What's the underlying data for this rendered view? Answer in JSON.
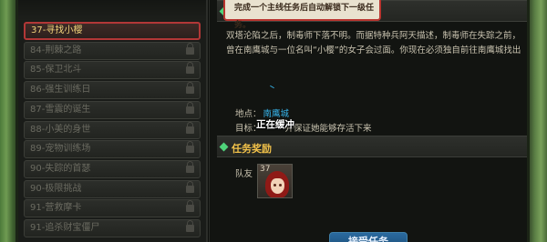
{
  "quest_list": [
    {
      "label": "37-寻找小樱",
      "active": true,
      "locked": false
    },
    {
      "label": "84-荆棘之路",
      "active": false,
      "locked": true
    },
    {
      "label": "85-保卫北斗",
      "active": false,
      "locked": true
    },
    {
      "label": "86-强生训练日",
      "active": false,
      "locked": true
    },
    {
      "label": "87-雪震的诞生",
      "active": false,
      "locked": true
    },
    {
      "label": "88-小美的身世",
      "active": false,
      "locked": true
    },
    {
      "label": "89-宠物训练场",
      "active": false,
      "locked": true
    },
    {
      "label": "90-失踪的首瑟",
      "active": false,
      "locked": true
    },
    {
      "label": "90-极限挑战",
      "active": false,
      "locked": true
    },
    {
      "label": "91-营救摩卡",
      "active": false,
      "locked": true
    },
    {
      "label": "91-追杀财宝僵尸",
      "active": false,
      "locked": true
    }
  ],
  "tooltip": "完成一个主线任务后自动解锁下一级任务。",
  "detail": {
    "description": "双塔沦陷之后，制毒师下落不明。而据特种兵阿天描述，制毒师在失踪之前，曾在南鹰城与一位名叫“小樱”的女子会过面。你现在必须独自前往南鹰城找出",
    "location_label": "地点：",
    "location_value": "南鹰城",
    "goal_label": "目标：",
    "goal_value": "并保证她能够存活下来",
    "loading_text": "正在缓冲"
  },
  "reward": {
    "section_title": "任务奖励",
    "teammate_label": "队友",
    "teammate_level": "37"
  },
  "accept_button": "接受任务",
  "colors": {
    "active_border": "#b23737",
    "quest_title": "#f2c24a",
    "location": "#36b2e8",
    "diamond": "#4fd37a"
  },
  "icons": {
    "lock": "lock-icon",
    "section": "diamond-icon"
  }
}
